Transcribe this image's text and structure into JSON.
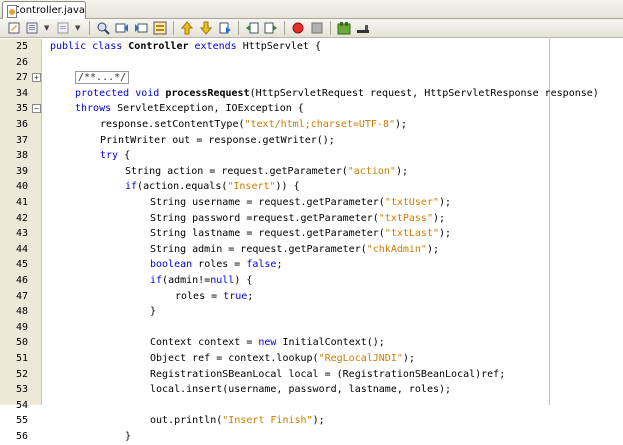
{
  "tab": {
    "label": "Controller.java",
    "close": "×"
  },
  "toolbar": {
    "icons": [
      "last-edit-icon",
      "back-icon",
      "forward-icon",
      "find-icon",
      "find-previous-icon",
      "find-next-icon",
      "toggle-highlight-icon",
      "previous-bookmark-icon",
      "next-bookmark-icon",
      "toggle-bookmark-icon",
      "shift-left-icon",
      "shift-right-icon",
      "start-macro-icon",
      "stop-macro-icon",
      "comment-icon",
      "uncomment-icon"
    ]
  },
  "colors": {
    "keyword": "#0000e6",
    "string": "#ce7b00",
    "gutter": "#ece9d8",
    "right_margin": "#f4a8a8"
  },
  "lines": [
    {
      "n": "25",
      "indent": 0,
      "fold": "",
      "tokens": [
        {
          "t": "public class ",
          "c": "kw"
        },
        {
          "t": "Controller",
          "c": "b"
        },
        {
          "t": " extends",
          "c": "kw"
        },
        {
          "t": " HttpServlet {",
          "c": ""
        }
      ]
    },
    {
      "n": "26",
      "indent": 0,
      "fold": "",
      "tokens": []
    },
    {
      "n": "27",
      "indent": 1,
      "fold": "+",
      "tokens": [
        {
          "t": "/**...*/",
          "c": "collapsed"
        }
      ]
    },
    {
      "n": "34",
      "indent": 1,
      "fold": "",
      "tokens": [
        {
          "t": "protected void ",
          "c": "kw"
        },
        {
          "t": "processRequest",
          "c": "b"
        },
        {
          "t": "(HttpServletRequest request, HttpServletResponse response)",
          "c": ""
        }
      ]
    },
    {
      "n": "35",
      "indent": 1,
      "fold": "−",
      "tokens": [
        {
          "t": "throws ",
          "c": "kw"
        },
        {
          "t": "ServletException, IOException {",
          "c": ""
        }
      ]
    },
    {
      "n": "36",
      "indent": 2,
      "fold": "",
      "tokens": [
        {
          "t": "response.setContentType(",
          "c": ""
        },
        {
          "t": "\"text/html;charset=UTF-8\"",
          "c": "str"
        },
        {
          "t": ");",
          "c": ""
        }
      ]
    },
    {
      "n": "37",
      "indent": 2,
      "fold": "",
      "tokens": [
        {
          "t": "PrintWriter out = response.getWriter();",
          "c": ""
        }
      ]
    },
    {
      "n": "38",
      "indent": 2,
      "fold": "",
      "tokens": [
        {
          "t": "try ",
          "c": "kw"
        },
        {
          "t": "{",
          "c": ""
        }
      ]
    },
    {
      "n": "39",
      "indent": 3,
      "fold": "",
      "tokens": [
        {
          "t": "String action = request.getParameter(",
          "c": ""
        },
        {
          "t": "\"action\"",
          "c": "str"
        },
        {
          "t": ");",
          "c": ""
        }
      ]
    },
    {
      "n": "40",
      "indent": 3,
      "fold": "",
      "tokens": [
        {
          "t": "if",
          "c": "kw"
        },
        {
          "t": "(action.equals(",
          "c": ""
        },
        {
          "t": "\"Insert\"",
          "c": "str"
        },
        {
          "t": ")) {",
          "c": ""
        }
      ]
    },
    {
      "n": "41",
      "indent": 4,
      "fold": "",
      "tokens": [
        {
          "t": "String username = request.getParameter(",
          "c": ""
        },
        {
          "t": "\"txtUser\"",
          "c": "str"
        },
        {
          "t": ");",
          "c": ""
        }
      ]
    },
    {
      "n": "42",
      "indent": 4,
      "fold": "",
      "tokens": [
        {
          "t": "String password =request.getParameter(",
          "c": ""
        },
        {
          "t": "\"txtPass\"",
          "c": "str"
        },
        {
          "t": ");",
          "c": ""
        }
      ]
    },
    {
      "n": "43",
      "indent": 4,
      "fold": "",
      "tokens": [
        {
          "t": "String lastname = request.getParameter(",
          "c": ""
        },
        {
          "t": "\"txtLast\"",
          "c": "str"
        },
        {
          "t": ");",
          "c": ""
        }
      ]
    },
    {
      "n": "44",
      "indent": 4,
      "fold": "",
      "tokens": [
        {
          "t": "String admin = request.getParameter(",
          "c": ""
        },
        {
          "t": "\"chkAdmin\"",
          "c": "str"
        },
        {
          "t": ");",
          "c": ""
        }
      ]
    },
    {
      "n": "45",
      "indent": 4,
      "fold": "",
      "tokens": [
        {
          "t": "boolean ",
          "c": "kw"
        },
        {
          "t": "roles = ",
          "c": ""
        },
        {
          "t": "false",
          "c": "kw"
        },
        {
          "t": ";",
          "c": ""
        }
      ]
    },
    {
      "n": "46",
      "indent": 4,
      "fold": "",
      "tokens": [
        {
          "t": "if",
          "c": "kw"
        },
        {
          "t": "(admin!=",
          "c": ""
        },
        {
          "t": "null",
          "c": "kw"
        },
        {
          "t": ") {",
          "c": ""
        }
      ]
    },
    {
      "n": "47",
      "indent": 5,
      "fold": "",
      "tokens": [
        {
          "t": "roles = ",
          "c": ""
        },
        {
          "t": "true",
          "c": "kw"
        },
        {
          "t": ";",
          "c": ""
        }
      ]
    },
    {
      "n": "48",
      "indent": 4,
      "fold": "",
      "tokens": [
        {
          "t": "}",
          "c": ""
        }
      ]
    },
    {
      "n": "49",
      "indent": 0,
      "fold": "",
      "tokens": []
    },
    {
      "n": "50",
      "indent": 4,
      "fold": "",
      "tokens": [
        {
          "t": "Context context = ",
          "c": ""
        },
        {
          "t": "new ",
          "c": "kw"
        },
        {
          "t": "InitialContext();",
          "c": ""
        }
      ]
    },
    {
      "n": "51",
      "indent": 4,
      "fold": "",
      "tokens": [
        {
          "t": "Object ref = context.lookup(",
          "c": ""
        },
        {
          "t": "\"RegLocalJNDI\"",
          "c": "str"
        },
        {
          "t": ");",
          "c": ""
        }
      ]
    },
    {
      "n": "52",
      "indent": 4,
      "fold": "",
      "tokens": [
        {
          "t": "RegistrationSBeanLocal local = (RegistrationSBeanLocal)ref;",
          "c": ""
        }
      ]
    },
    {
      "n": "53",
      "indent": 4,
      "fold": "",
      "tokens": [
        {
          "t": "local.insert(username, password, lastname, roles);",
          "c": ""
        }
      ]
    },
    {
      "n": "54",
      "indent": 0,
      "fold": "",
      "tokens": []
    },
    {
      "n": "55",
      "indent": 4,
      "fold": "",
      "tokens": [
        {
          "t": "out.println(",
          "c": ""
        },
        {
          "t": "\"Insert Finish\"",
          "c": "str"
        },
        {
          "t": ");",
          "c": ""
        }
      ]
    },
    {
      "n": "56",
      "indent": 3,
      "fold": "",
      "tokens": [
        {
          "t": "}",
          "c": ""
        }
      ]
    }
  ]
}
